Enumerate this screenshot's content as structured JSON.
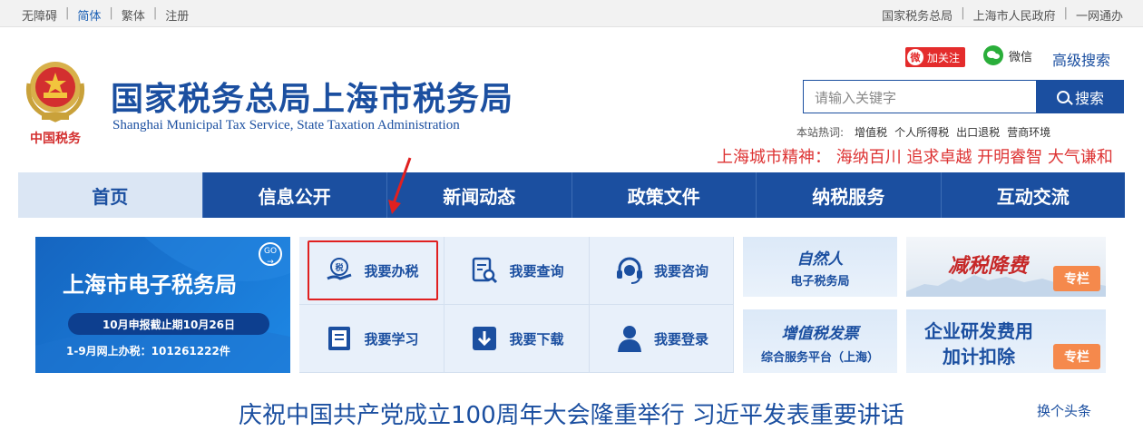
{
  "topbar": {
    "left": [
      "无障碍",
      "简体",
      "繁体",
      "注册"
    ],
    "right": [
      "国家税务总局",
      "上海市人民政府",
      "一网通办"
    ]
  },
  "header": {
    "emblem_caption": "中国税务",
    "title": "国家税务总局上海市税务局",
    "subtitle": "Shanghai Municipal Tax Service, State Taxation Administration",
    "follow_label": "加关注",
    "wechat_label": "微信",
    "advanced_search": "高级搜索",
    "search_placeholder": "请输入关键字",
    "search_button": "搜索",
    "hotwords_label": "本站热词:",
    "hotwords": [
      "增值税",
      "个人所得税",
      "出口退税",
      "营商环境"
    ],
    "spirit": "上海城市精神：  海纳百川 追求卓越 开明睿智 大气谦和"
  },
  "nav": [
    "首页",
    "信息公开",
    "新闻动态",
    "政策文件",
    "纳税服务",
    "互动交流"
  ],
  "banner": {
    "title": "上海市电子税务局",
    "go": "GO",
    "deadline": "10月申报截止期10月26日",
    "count": "1-9月网上办税：101261222件"
  },
  "services": [
    "我要办税",
    "我要查询",
    "我要咨询",
    "我要学习",
    "我要下载",
    "我要登录"
  ],
  "promos": {
    "natural_person_1": "自然人",
    "natural_person_2": "电子税务局",
    "tax_cut": "减税降费",
    "tag": "专栏",
    "vat_1": "增值税发票",
    "vat_2": "综合服务平台（上海）",
    "rd_1": "企业研发费用",
    "rd_2": "加计扣除"
  },
  "headline": "庆祝中国共产党成立100周年大会隆重举行 习近平发表重要讲话",
  "swap": "换个头条"
}
